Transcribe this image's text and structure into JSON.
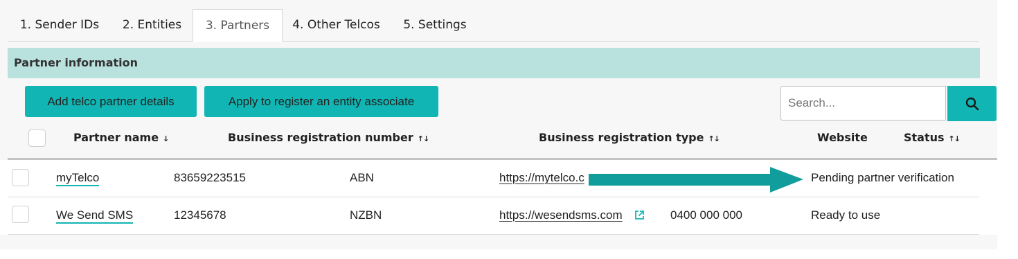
{
  "tabs": [
    {
      "label": "1. Sender IDs"
    },
    {
      "label": "2. Entities"
    },
    {
      "label": "3. Partners",
      "active": true
    },
    {
      "label": "4. Other Telcos"
    },
    {
      "label": "5. Settings"
    }
  ],
  "section": {
    "title": "Partner information"
  },
  "toolbar": {
    "add_label": "Add telco partner details",
    "apply_label": "Apply to register an entity associate",
    "search_placeholder": "Search..."
  },
  "columns": [
    {
      "label": "Partner name",
      "sort": "↓"
    },
    {
      "label": "Business registration number",
      "sort": "↑↓"
    },
    {
      "label": "Business registration type",
      "sort": "↑↓"
    },
    {
      "label": "Website",
      "sort": ""
    },
    {
      "label": "Status",
      "sort": "↑↓"
    }
  ],
  "rows": [
    {
      "name": "myTelco",
      "number": "83659223515",
      "type": "ABN",
      "website": "https://mytelco.c",
      "phone": "",
      "status": "Pending partner verification"
    },
    {
      "name": "We Send SMS",
      "number": "12345678",
      "type": "NZBN",
      "website": "https://wesendsms.com",
      "phone": "0400 000 000",
      "status": "Ready to use"
    }
  ],
  "colors": {
    "accent": "#11b5b3",
    "header_bg": "#b9e2df",
    "arrow": "#109d9b"
  },
  "icons": {
    "search": "search-icon",
    "external": "external-link-icon",
    "annotation": "arrow-right-icon"
  }
}
